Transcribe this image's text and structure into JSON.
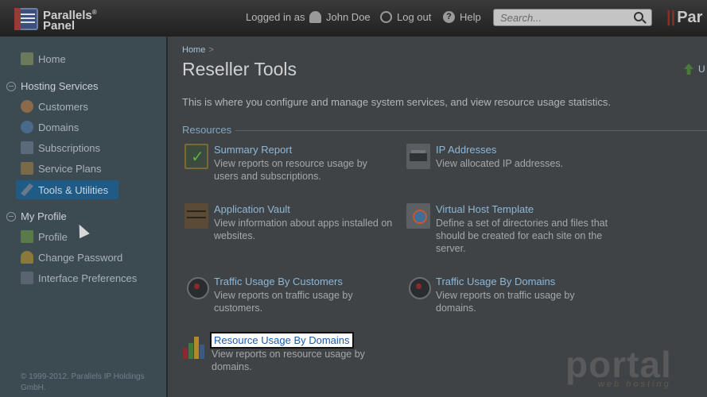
{
  "topbar": {
    "logo": "Parallels® Panel",
    "logged_in_as": "Logged in as",
    "user_name": "John Doe",
    "logout": "Log out",
    "help": "Help",
    "search_placeholder": "Search...",
    "brand_right": "Par"
  },
  "sidebar": {
    "home": "Home",
    "hosting_services": "Hosting Services",
    "customers": "Customers",
    "domains": "Domains",
    "subscriptions": "Subscriptions",
    "service_plans": "Service Plans",
    "tools_utilities": "Tools & Utilities",
    "my_profile": "My Profile",
    "profile": "Profile",
    "change_password": "Change Password",
    "interface_preferences": "Interface Preferences",
    "copyright": "© 1999-2012. Parallels IP Holdings GmbH."
  },
  "main": {
    "breadcrumb_home": "Home",
    "breadcrumb_sep": ">",
    "title": "Reseller Tools",
    "upgrade_partial": "U",
    "description": "This is where you configure and manage system services, and view resource usage statistics.",
    "section": "Resources",
    "tools": [
      {
        "title": "Summary Report",
        "desc": "View reports on resource usage by users and subscriptions.",
        "icon": "summary-report-icon"
      },
      {
        "title": "IP Addresses",
        "desc": "View allocated IP addresses.",
        "icon": "ip-addresses-icon"
      },
      {
        "title": "Application Vault",
        "desc": "View information about apps installed on websites.",
        "icon": "application-vault-icon"
      },
      {
        "title": "Virtual Host Template",
        "desc": "Define a set of directories and files that should be created for each site on the server.",
        "icon": "virtual-host-template-icon"
      },
      {
        "title": "Traffic Usage By Customers",
        "desc": "View reports on traffic usage by customers.",
        "icon": "traffic-customers-icon"
      },
      {
        "title": "Traffic Usage By Domains",
        "desc": "View reports on traffic usage by domains.",
        "icon": "traffic-domains-icon"
      },
      {
        "title": "Resource Usage By Domains",
        "desc": "View reports on resource usage by domains.",
        "icon": "resource-usage-icon"
      }
    ]
  },
  "watermark": {
    "text": "portal",
    "sub": "web hosting"
  }
}
